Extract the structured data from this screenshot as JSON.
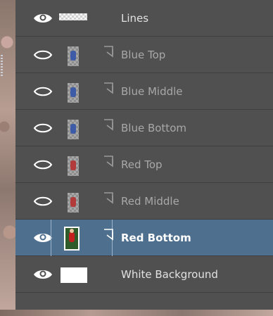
{
  "layers": [
    {
      "name": "Lines",
      "visible": true,
      "thumbnail": "checker-white",
      "clipped": false,
      "selected": false
    },
    {
      "name": "Blue Top",
      "visible": false,
      "thumbnail": "player-blue",
      "clipped": true,
      "selected": false
    },
    {
      "name": "Blue Middle",
      "visible": false,
      "thumbnail": "player-blue",
      "clipped": true,
      "selected": false
    },
    {
      "name": "Blue Bottom",
      "visible": false,
      "thumbnail": "player-blue",
      "clipped": true,
      "selected": false
    },
    {
      "name": "Red Top",
      "visible": false,
      "thumbnail": "player-red",
      "clipped": true,
      "selected": false
    },
    {
      "name": "Red Middle",
      "visible": false,
      "thumbnail": "player-red",
      "clipped": true,
      "selected": false
    },
    {
      "name": "Red Bottom",
      "visible": true,
      "thumbnail": "player-red-large",
      "clipped": true,
      "selected": true
    },
    {
      "name": "White Background",
      "visible": true,
      "thumbnail": "solid-white",
      "clipped": false,
      "selected": false
    }
  ],
  "colors": {
    "panel": "#505050",
    "selected_row": "#4e6f8e",
    "text_visible": "#e2e2e2",
    "text_hidden": "#a8a8a8"
  },
  "icons": {
    "visible": "eye-open-icon",
    "hidden": "eye-closed-icon",
    "clipping": "clipping-mask-icon"
  }
}
